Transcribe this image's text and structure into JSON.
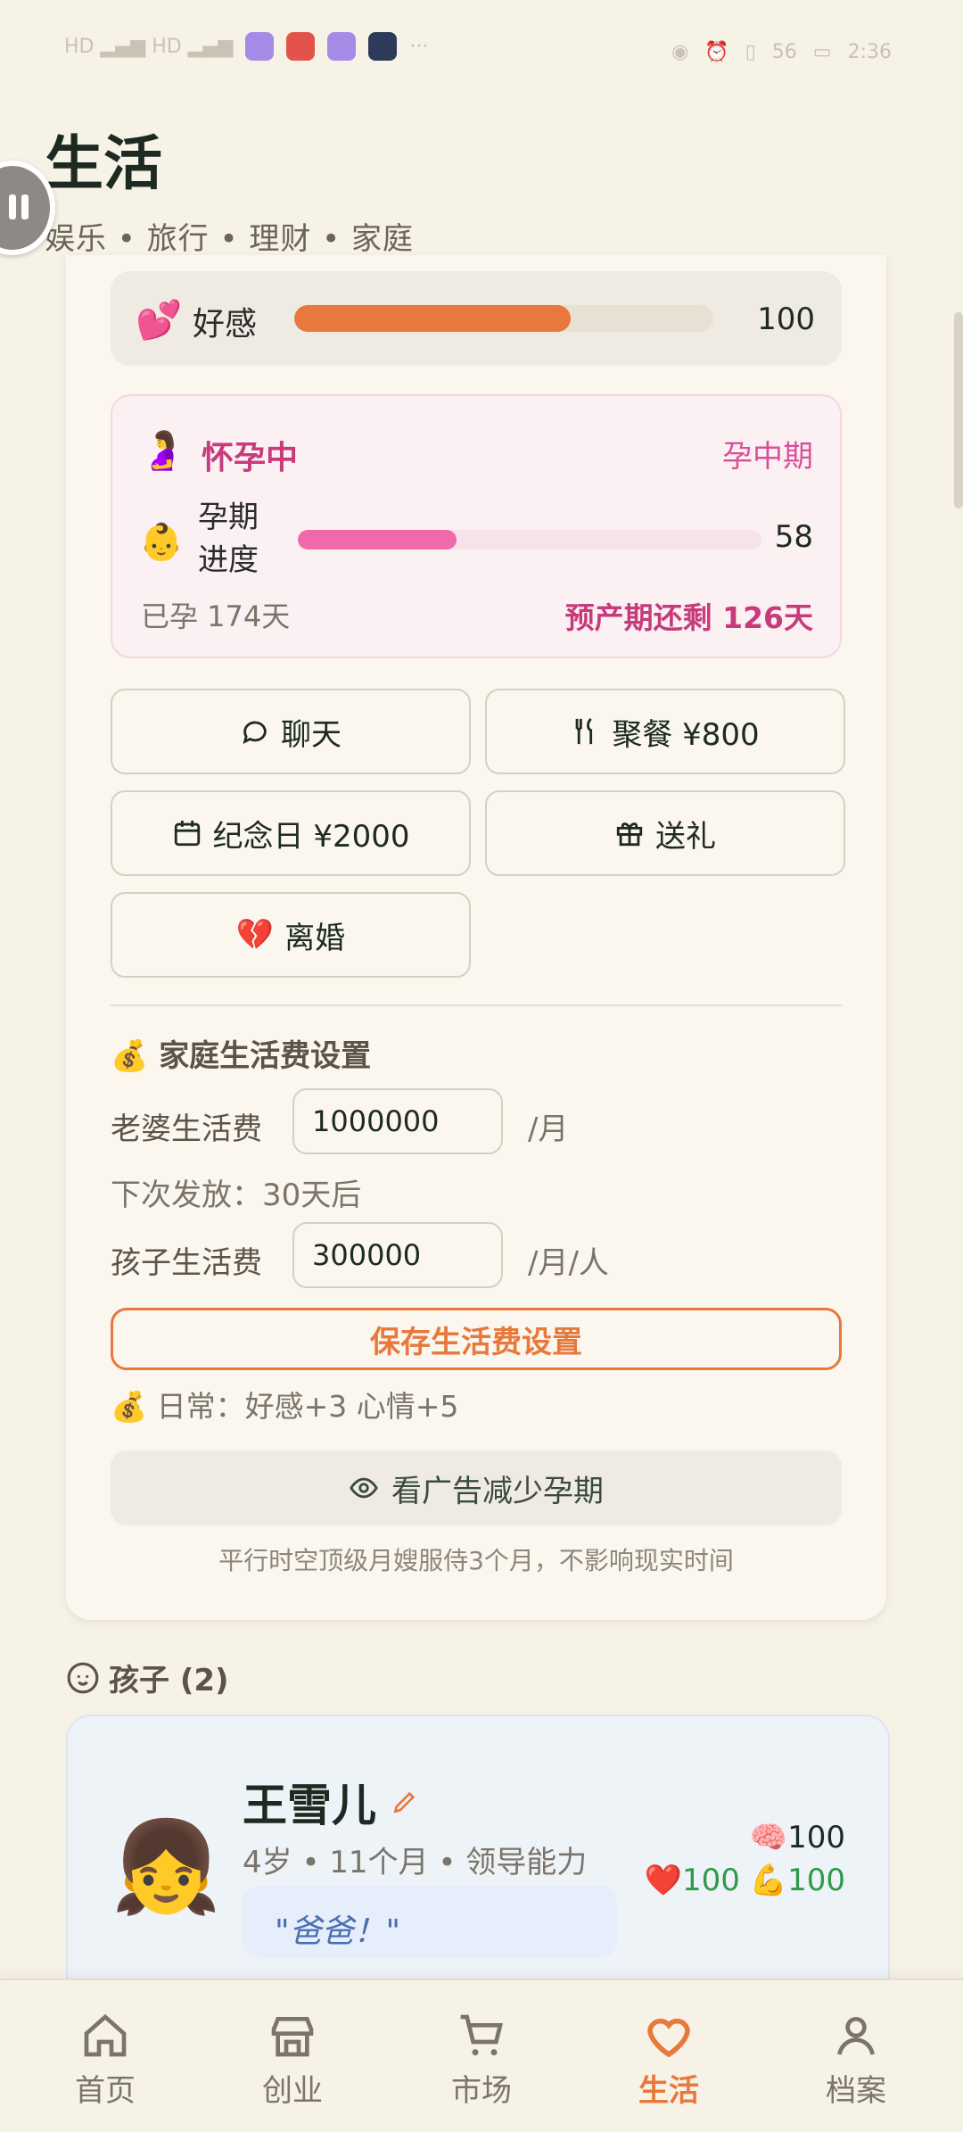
{
  "header": {
    "title": "生活",
    "subtitle": "娱乐 • 旅行 • 理财 • 家庭"
  },
  "status_bar": {
    "time": "2:36",
    "battery": "56"
  },
  "spouse": {
    "affection_label": "好感",
    "affection_value": "100",
    "affection_fraction": 1.0,
    "pregnancy": {
      "state": "怀孕中",
      "stage": "孕中期",
      "progress_label": "孕期\n进度",
      "progress_value": "58",
      "progress_fraction": 0.58,
      "days_pregnant": "已孕 174天",
      "due_remaining": "预产期还剩 126天"
    },
    "actions": {
      "chat": "聊天",
      "dinner": "聚餐 ¥800",
      "anniversary": "纪念日 ¥2000",
      "gift": "送礼",
      "divorce": "离婚"
    },
    "allowance": {
      "title": "家庭生活费设置",
      "wife_label": "老婆生活费",
      "wife_value": "1000000",
      "wife_unit": "/月",
      "next_payment": "下次发放：30天后",
      "child_label": "孩子生活费",
      "child_value": "300000",
      "child_unit": "/月/人",
      "save_label": "保存生活费设置",
      "daily_effect": "日常：好感+3 心情+5"
    },
    "ad_button": "看广告减少孕期",
    "ad_note": "平行时空顶级月嫂服侍3个月，不影响现实时间"
  },
  "kids": {
    "title": "孩子 (2)",
    "items": [
      {
        "name": "王雪儿",
        "meta": "4岁 • 11个月 • 领导能力",
        "quote": "\"爸爸！\"",
        "stat_intelligence": "100",
        "stat_health": "100",
        "stat_strength": "100"
      }
    ]
  },
  "nav": {
    "items": [
      {
        "label": "首页",
        "icon": "home-icon"
      },
      {
        "label": "创业",
        "icon": "store-icon"
      },
      {
        "label": "市场",
        "icon": "cart-icon"
      },
      {
        "label": "生活",
        "icon": "heart-icon",
        "active": true
      },
      {
        "label": "档案",
        "icon": "person-icon"
      }
    ]
  },
  "colors": {
    "accent": "#e8783c",
    "pink": "#c73b7d",
    "background": "#f7f2e6"
  }
}
